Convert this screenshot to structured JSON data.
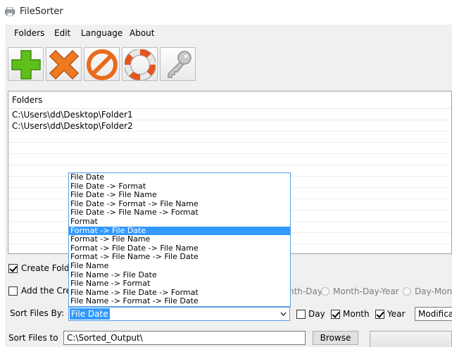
{
  "window": {
    "title": "FileSorter"
  },
  "menu": [
    "Folders",
    "Edit",
    "Language",
    "About"
  ],
  "toolbar": [
    {
      "name": "add-folder",
      "icon": "plus-icon"
    },
    {
      "name": "remove-folder",
      "icon": "x-icon"
    },
    {
      "name": "clear",
      "icon": "no-entry-icon"
    },
    {
      "name": "help",
      "icon": "lifebuoy-icon"
    },
    {
      "name": "register",
      "icon": "key-icon"
    }
  ],
  "folders": {
    "header": "Folders",
    "items": [
      "C:\\Users\\dd\\Desktop\\Folder1",
      "C:\\Users\\dd\\Desktop\\Folder2"
    ]
  },
  "options": {
    "create_folder": {
      "label": "Create Fold",
      "checked": true
    },
    "add_created": {
      "label": "Add the Cre",
      "checked": false
    },
    "date_formats": [
      "nth-Day",
      "Month-Day-Year",
      "Day-Mont"
    ]
  },
  "sort_by": {
    "label": "Sort Files By:",
    "selected": "File Date",
    "options": [
      "File Date",
      "File Date -> Format",
      "File Date -> File Name",
      "File Date -> Format -> File Name",
      "File Date -> File Name -> Format",
      "Format",
      "Format -> File Date",
      "Format -> File Name",
      "Format -> File Date -> File Name",
      "Format -> File Name -> File Date",
      "File Name",
      "File Name -> File Date",
      "File Name -> Format",
      "File Name -> File Date -> Format",
      "File Name -> Format -> File Date"
    ],
    "highlighted": "Format -> File Date"
  },
  "date_parts": {
    "day": {
      "label": "Day",
      "checked": false
    },
    "month": {
      "label": "Month",
      "checked": true
    },
    "year": {
      "label": "Year",
      "checked": true
    }
  },
  "date_source": {
    "value": "Modificati"
  },
  "sort_to": {
    "label": "Sort Files to",
    "value": "C:\\Sorted_Output\\",
    "browse": "Browse"
  }
}
